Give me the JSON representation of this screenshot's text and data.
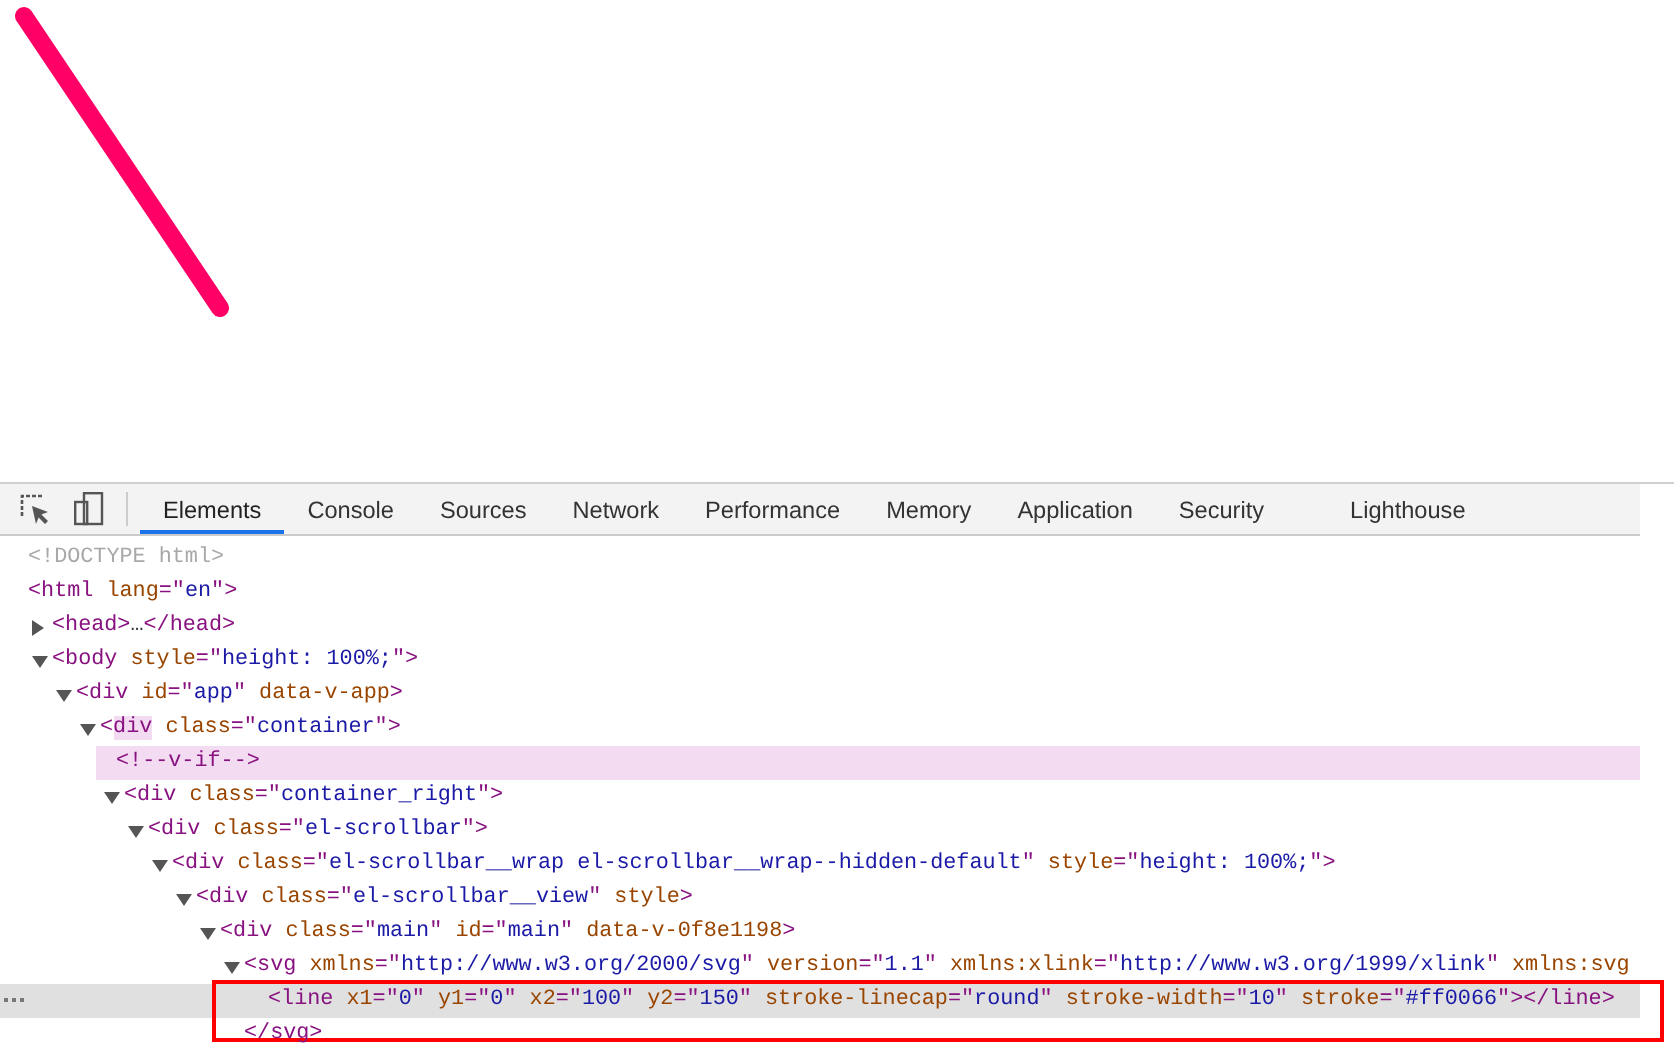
{
  "tabs": [
    {
      "label": "Elements",
      "selected": true
    },
    {
      "label": "Console",
      "selected": false
    },
    {
      "label": "Sources",
      "selected": false
    },
    {
      "label": "Network",
      "selected": false
    },
    {
      "label": "Performance",
      "selected": false
    },
    {
      "label": "Memory",
      "selected": false
    },
    {
      "label": "Application",
      "selected": false
    },
    {
      "label": "Security",
      "selected": false
    },
    {
      "label": "Lighthouse",
      "selected": false
    }
  ],
  "tree": [
    {
      "tokens": [
        {
          "kind": "doctype",
          "text": "<!DOCTYPE html>"
        }
      ],
      "selected": false,
      "hovered": false
    },
    {
      "tokens": [
        {
          "kind": "tag",
          "text": "<html "
        },
        {
          "kind": "attr",
          "text": "lang"
        },
        {
          "kind": "tag",
          "text": "=\""
        },
        {
          "kind": "value",
          "text": "en"
        },
        {
          "kind": "tag",
          "text": "\">"
        }
      ],
      "selected": false,
      "hovered": false,
      "children": [
        {
          "tokens": [
            {
              "kind": "tag",
              "text": "<head>"
            },
            {
              "kind": "ellipsis",
              "text": "…"
            },
            {
              "kind": "tag",
              "text": "</head>"
            }
          ],
          "expanded": false,
          "selected": false,
          "hovered": false
        },
        {
          "tokens": [
            {
              "kind": "tag",
              "text": "<body "
            },
            {
              "kind": "attr",
              "text": "style"
            },
            {
              "kind": "tag",
              "text": "=\""
            },
            {
              "kind": "value",
              "text": "height: 100%;"
            },
            {
              "kind": "tag",
              "text": "\">"
            }
          ],
          "expanded": true,
          "selected": false,
          "hovered": false,
          "children": [
            {
              "tokens": [
                {
                  "kind": "tag",
                  "text": "<div "
                },
                {
                  "kind": "attr",
                  "text": "id"
                },
                {
                  "kind": "tag",
                  "text": "=\""
                },
                {
                  "kind": "value",
                  "text": "app"
                },
                {
                  "kind": "tag",
                  "text": "\" "
                },
                {
                  "kind": "attr",
                  "text": "data-v-app"
                },
                {
                  "kind": "tag",
                  "text": ">"
                }
              ],
              "expanded": true,
              "selected": false,
              "hovered": false,
              "children": [
                {
                  "tokens": [
                    {
                      "kind": "tag",
                      "text": "<"
                    },
                    {
                      "kind": "highlight",
                      "text": "div"
                    },
                    {
                      "kind": "attr",
                      "text": " class"
                    },
                    {
                      "kind": "tag",
                      "text": "=\""
                    },
                    {
                      "kind": "value",
                      "text": "container"
                    },
                    {
                      "kind": "tag",
                      "text": "\">"
                    }
                  ],
                  "expanded": true,
                  "selected": false,
                  "hovered": false,
                  "children": [
                    {
                      "tokens": [
                        {
                          "kind": "tag",
                          "text": "<!--v-if-->"
                        }
                      ],
                      "selected": false,
                      "hovered": true
                    },
                    {
                      "tokens": [
                        {
                          "kind": "tag",
                          "text": "<div "
                        },
                        {
                          "kind": "attr",
                          "text": "class"
                        },
                        {
                          "kind": "tag",
                          "text": "=\""
                        },
                        {
                          "kind": "value",
                          "text": "container_right"
                        },
                        {
                          "kind": "tag",
                          "text": "\">"
                        }
                      ],
                      "expanded": true,
                      "selected": false,
                      "hovered": false,
                      "children": [
                        {
                          "tokens": [
                            {
                              "kind": "tag",
                              "text": "<div "
                            },
                            {
                              "kind": "attr",
                              "text": "class"
                            },
                            {
                              "kind": "tag",
                              "text": "=\""
                            },
                            {
                              "kind": "value",
                              "text": "el-scrollbar"
                            },
                            {
                              "kind": "tag",
                              "text": "\">"
                            }
                          ],
                          "expanded": true,
                          "selected": false,
                          "hovered": false,
                          "children": [
                            {
                              "tokens": [
                                {
                                  "kind": "tag",
                                  "text": "<div "
                                },
                                {
                                  "kind": "attr",
                                  "text": "class"
                                },
                                {
                                  "kind": "tag",
                                  "text": "=\""
                                },
                                {
                                  "kind": "value",
                                  "text": "el-scrollbar__wrap el-scrollbar__wrap--hidden-default"
                                },
                                {
                                  "kind": "tag",
                                  "text": "\" "
                                },
                                {
                                  "kind": "attr",
                                  "text": "style"
                                },
                                {
                                  "kind": "tag",
                                  "text": "=\""
                                },
                                {
                                  "kind": "value",
                                  "text": "height: 100%;"
                                },
                                {
                                  "kind": "tag",
                                  "text": "\">"
                                }
                              ],
                              "expanded": true,
                              "selected": false,
                              "hovered": false,
                              "children": [
                                {
                                  "tokens": [
                                    {
                                      "kind": "tag",
                                      "text": "<div "
                                    },
                                    {
                                      "kind": "attr",
                                      "text": "class"
                                    },
                                    {
                                      "kind": "tag",
                                      "text": "=\""
                                    },
                                    {
                                      "kind": "value",
                                      "text": "el-scrollbar__view"
                                    },
                                    {
                                      "kind": "tag",
                                      "text": "\" "
                                    },
                                    {
                                      "kind": "attr",
                                      "text": "style"
                                    },
                                    {
                                      "kind": "tag",
                                      "text": ">"
                                    }
                                  ],
                                  "expanded": true,
                                  "selected": false,
                                  "hovered": false,
                                  "children": [
                                    {
                                      "tokens": [
                                        {
                                          "kind": "tag",
                                          "text": "<div "
                                        },
                                        {
                                          "kind": "attr",
                                          "text": "class"
                                        },
                                        {
                                          "kind": "tag",
                                          "text": "=\""
                                        },
                                        {
                                          "kind": "value",
                                          "text": "main"
                                        },
                                        {
                                          "kind": "tag",
                                          "text": "\" "
                                        },
                                        {
                                          "kind": "attr",
                                          "text": "id"
                                        },
                                        {
                                          "kind": "tag",
                                          "text": "=\""
                                        },
                                        {
                                          "kind": "value",
                                          "text": "main"
                                        },
                                        {
                                          "kind": "tag",
                                          "text": "\" "
                                        },
                                        {
                                          "kind": "attr",
                                          "text": "data-v-0f8e1198"
                                        },
                                        {
                                          "kind": "tag",
                                          "text": ">"
                                        }
                                      ],
                                      "expanded": true,
                                      "selected": false,
                                      "hovered": false,
                                      "children": [
                                        {
                                          "tokens": [
                                            {
                                              "kind": "tag",
                                              "text": "<svg "
                                            },
                                            {
                                              "kind": "attr",
                                              "text": "xmlns"
                                            },
                                            {
                                              "kind": "tag",
                                              "text": "=\""
                                            },
                                            {
                                              "kind": "value",
                                              "text": "http://www.w3.org/2000/svg"
                                            },
                                            {
                                              "kind": "tag",
                                              "text": "\" "
                                            },
                                            {
                                              "kind": "attr",
                                              "text": "version"
                                            },
                                            {
                                              "kind": "tag",
                                              "text": "=\""
                                            },
                                            {
                                              "kind": "value",
                                              "text": "1.1"
                                            },
                                            {
                                              "kind": "tag",
                                              "text": "\" "
                                            },
                                            {
                                              "kind": "attr",
                                              "text": "xmlns:xlink"
                                            },
                                            {
                                              "kind": "tag",
                                              "text": "=\""
                                            },
                                            {
                                              "kind": "value",
                                              "text": "http://www.w3.org/1999/xlink"
                                            },
                                            {
                                              "kind": "tag",
                                              "text": "\" "
                                            },
                                            {
                                              "kind": "attr",
                                              "text": "xmlns:svg"
                                            }
                                          ],
                                          "expanded": true,
                                          "selected": false,
                                          "hovered": false,
                                          "closing": [
                                            {
                                              "kind": "tag",
                                              "text": "</svg>"
                                            }
                                          ],
                                          "children": [
                                            {
                                              "tokens": [
                                                {
                                                  "kind": "tag",
                                                  "text": "<line "
                                                },
                                                {
                                                  "kind": "attr",
                                                  "text": "x1"
                                                },
                                                {
                                                  "kind": "tag",
                                                  "text": "=\""
                                                },
                                                {
                                                  "kind": "value",
                                                  "text": "0"
                                                },
                                                {
                                                  "kind": "tag",
                                                  "text": "\" "
                                                },
                                                {
                                                  "kind": "attr",
                                                  "text": "y1"
                                                },
                                                {
                                                  "kind": "tag",
                                                  "text": "=\""
                                                },
                                                {
                                                  "kind": "value",
                                                  "text": "0"
                                                },
                                                {
                                                  "kind": "tag",
                                                  "text": "\" "
                                                },
                                                {
                                                  "kind": "attr",
                                                  "text": "x2"
                                                },
                                                {
                                                  "kind": "tag",
                                                  "text": "=\""
                                                },
                                                {
                                                  "kind": "value",
                                                  "text": "100"
                                                },
                                                {
                                                  "kind": "tag",
                                                  "text": "\" "
                                                },
                                                {
                                                  "kind": "attr",
                                                  "text": "y2"
                                                },
                                                {
                                                  "kind": "tag",
                                                  "text": "=\""
                                                },
                                                {
                                                  "kind": "value",
                                                  "text": "150"
                                                },
                                                {
                                                  "kind": "tag",
                                                  "text": "\" "
                                                },
                                                {
                                                  "kind": "attr",
                                                  "text": "stroke-linecap"
                                                },
                                                {
                                                  "kind": "tag",
                                                  "text": "=\""
                                                },
                                                {
                                                  "kind": "value",
                                                  "text": "round"
                                                },
                                                {
                                                  "kind": "tag",
                                                  "text": "\" "
                                                },
                                                {
                                                  "kind": "attr",
                                                  "text": "stroke-width"
                                                },
                                                {
                                                  "kind": "tag",
                                                  "text": "=\""
                                                },
                                                {
                                                  "kind": "value",
                                                  "text": "10"
                                                },
                                                {
                                                  "kind": "tag",
                                                  "text": "\" "
                                                },
                                                {
                                                  "kind": "attr",
                                                  "text": "stroke"
                                                },
                                                {
                                                  "kind": "tag",
                                                  "text": "=\""
                                                },
                                                {
                                                  "kind": "value",
                                                  "text": "#ff0066"
                                                },
                                                {
                                                  "kind": "tag",
                                                  "text": "\"></line>"
                                                }
                                              ],
                                              "selected": true,
                                              "hovered": false,
                                              "annotated": true
                                            }
                                          ]
                                        }
                                      ]
                                    }
                                  ]
                                }
                              ]
                            }
                          ]
                        }
                      ]
                    }
                  ]
                }
              ]
            }
          ]
        }
      ]
    }
  ]
}
